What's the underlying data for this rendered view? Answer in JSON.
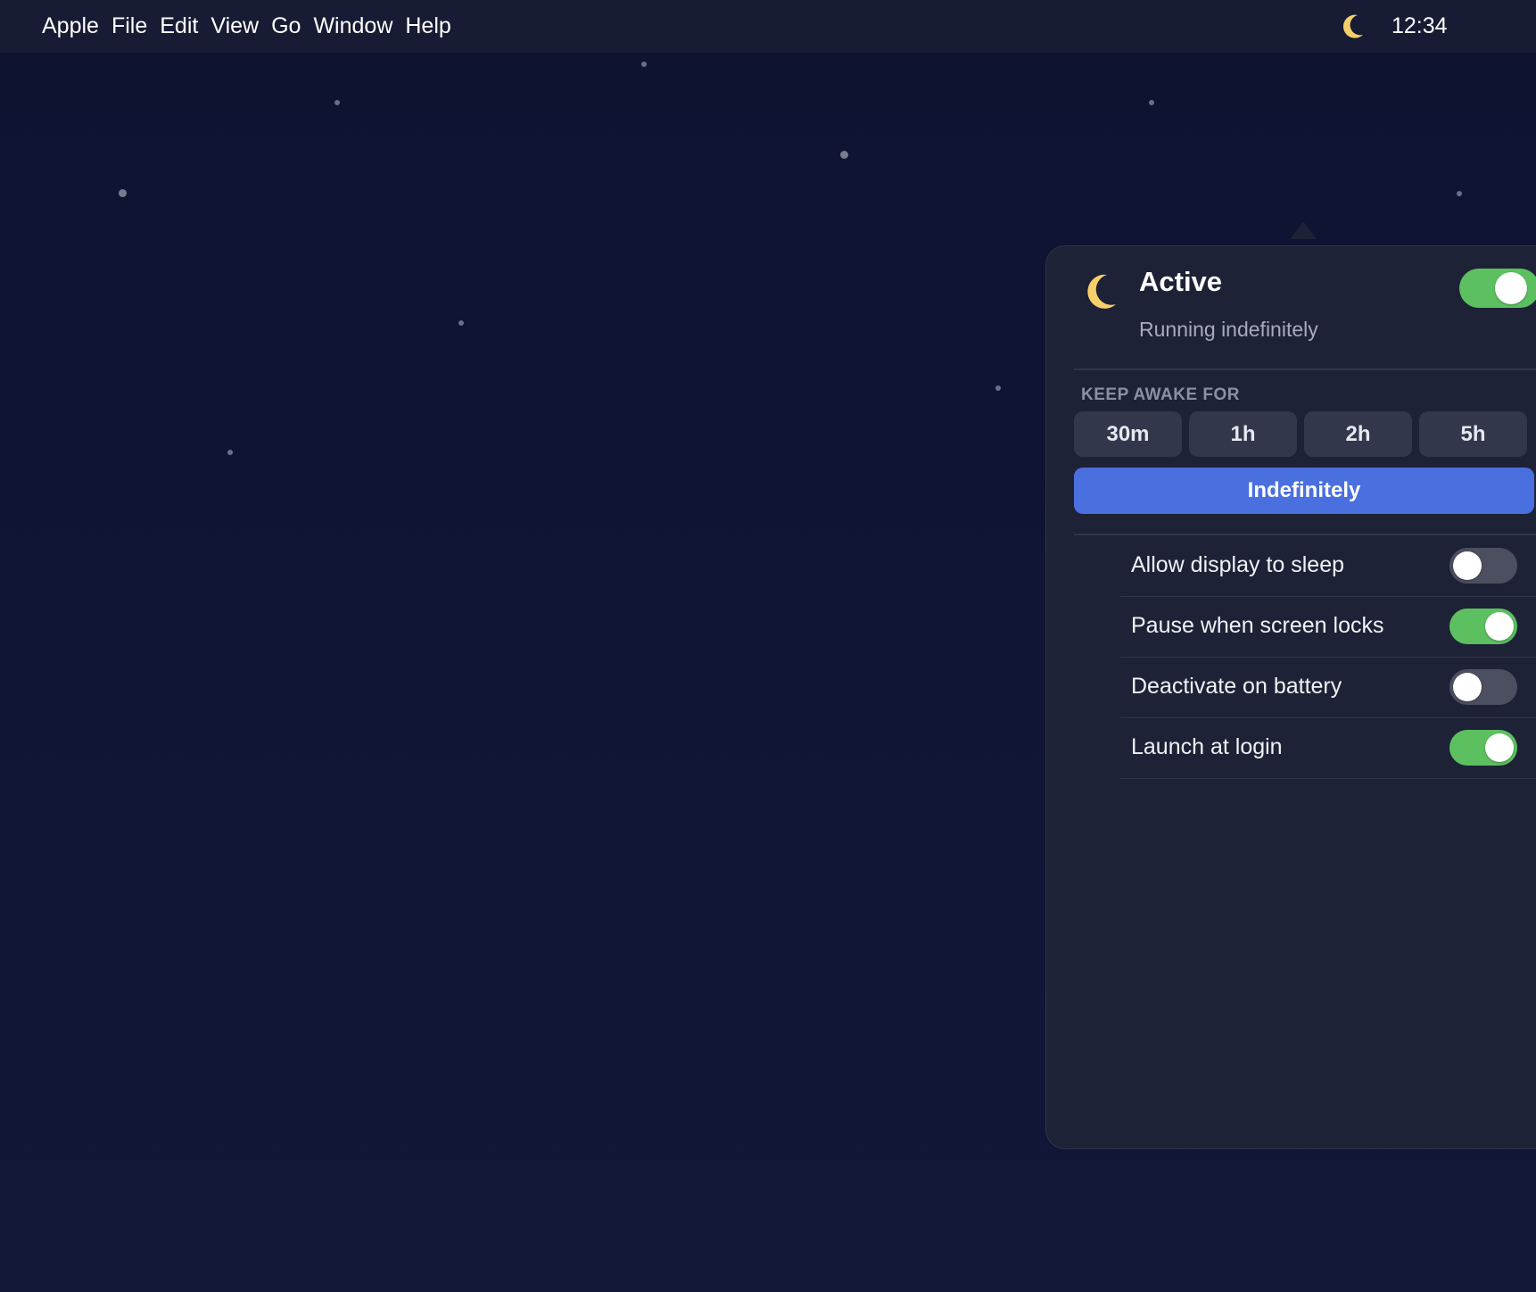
{
  "menubar": {
    "items": [
      "Apple",
      "File",
      "Edit",
      "View",
      "Go",
      "Window",
      "Help"
    ],
    "clock": "12:34",
    "status_icon": "moon-icon"
  },
  "panel": {
    "status": {
      "icon": "moon-icon",
      "title": "Active",
      "subtitle": "Running indefinitely",
      "active": true
    },
    "keep_awake": {
      "label": "KEEP AWAKE FOR",
      "durations": [
        "30m",
        "1h",
        "2h",
        "5h"
      ],
      "indefinite_label": "Indefinitely",
      "selected": "Indefinitely"
    },
    "options": [
      {
        "label": "Allow display to sleep",
        "enabled": false
      },
      {
        "label": "Pause when screen locks",
        "enabled": true
      },
      {
        "label": "Deactivate on battery",
        "enabled": false
      },
      {
        "label": "Launch at login",
        "enabled": true
      }
    ]
  },
  "colors": {
    "desktop": "#0f1430",
    "menubar": "#171b33",
    "panel": "#1e2236",
    "toggle_on": "#5cc060",
    "toggle_off": "#4b4f60",
    "accent": "#4a6fde",
    "moon": "#f5d06a"
  }
}
